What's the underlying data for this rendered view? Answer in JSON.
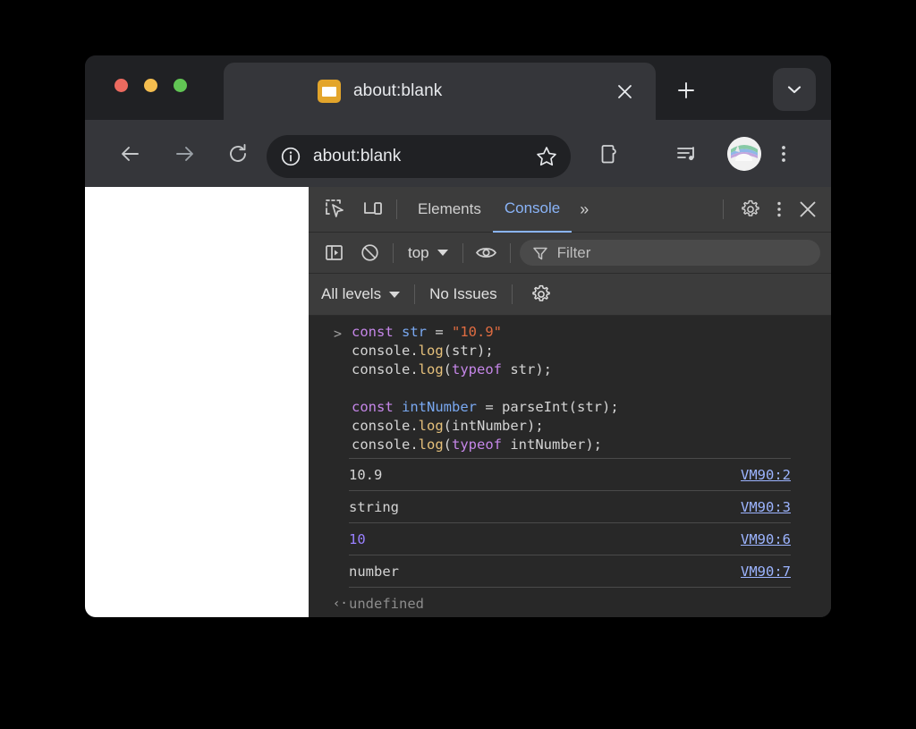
{
  "browser": {
    "tab": {
      "title": "about:blank",
      "favicon": "page-favicon",
      "close_label": "×"
    },
    "new_tab_label": "+",
    "tab_list_menu": "chevron-down-icon",
    "toolbar": {
      "back": "back-arrow-icon",
      "forward": "forward-arrow-icon",
      "reload": "reload-icon",
      "url": "about:blank",
      "site_info": "info-icon",
      "bookmark": "star-icon",
      "extensions": "extensions-puzzle-icon",
      "media": "media-list-icon",
      "profile": "avatar-unicorn",
      "menu": "three-dot-menu-icon"
    }
  },
  "devtools": {
    "header": {
      "inspect_icon": "inspect-element-icon",
      "device_icon": "device-toolbar-icon",
      "tabs": [
        {
          "label": "Elements",
          "active": false
        },
        {
          "label": "Console",
          "active": true
        }
      ],
      "more_tabs": "»",
      "settings_icon": "gear-icon",
      "menu_icon": "three-dot-menu-icon",
      "close_icon": "close-icon"
    },
    "console_bar": {
      "sidebar_icon": "console-sidebar-icon",
      "clear_icon": "clear-console-icon",
      "context": "top",
      "eye_icon": "live-expression-eye-icon",
      "filter_icon": "filter-funnel-icon",
      "filter_placeholder": "Filter",
      "filter_value": ""
    },
    "console_bar2": {
      "levels": "All levels",
      "issues": "No Issues",
      "settings_icon": "gear-icon"
    },
    "console": {
      "prompt_symbol": ">",
      "input_lines": [
        [
          {
            "t": "const",
            "c": "k-const"
          },
          {
            "t": " ",
            "c": "k-plain"
          },
          {
            "t": "str",
            "c": "k-var"
          },
          {
            "t": " = ",
            "c": "k-op"
          },
          {
            "t": "\"10.9\"",
            "c": "k-str"
          }
        ],
        [
          {
            "t": "console",
            "c": "k-plain"
          },
          {
            "t": ".",
            "c": "k-plain"
          },
          {
            "t": "log",
            "c": "k-yellow"
          },
          {
            "t": "(str);",
            "c": "k-plain"
          }
        ],
        [
          {
            "t": "console",
            "c": "k-plain"
          },
          {
            "t": ".",
            "c": "k-plain"
          },
          {
            "t": "log",
            "c": "k-yellow"
          },
          {
            "t": "(",
            "c": "k-plain"
          },
          {
            "t": "typeof",
            "c": "k-typeof"
          },
          {
            "t": " str);",
            "c": "k-plain"
          }
        ],
        [
          {
            "t": " ",
            "c": "k-plain"
          }
        ],
        [
          {
            "t": "const",
            "c": "k-const"
          },
          {
            "t": " ",
            "c": "k-plain"
          },
          {
            "t": "intNumber",
            "c": "k-var"
          },
          {
            "t": " = parseInt(str);",
            "c": "k-op"
          }
        ],
        [
          {
            "t": "console",
            "c": "k-plain"
          },
          {
            "t": ".",
            "c": "k-plain"
          },
          {
            "t": "log",
            "c": "k-yellow"
          },
          {
            "t": "(intNumber);",
            "c": "k-plain"
          }
        ],
        [
          {
            "t": "console",
            "c": "k-plain"
          },
          {
            "t": ".",
            "c": "k-plain"
          },
          {
            "t": "log",
            "c": "k-yellow"
          },
          {
            "t": "(",
            "c": "k-plain"
          },
          {
            "t": "typeof",
            "c": "k-typeof"
          },
          {
            "t": " intNumber);",
            "c": "k-plain"
          }
        ]
      ],
      "outputs": [
        {
          "value": "10.9",
          "kind": "string",
          "source": "VM90:2"
        },
        {
          "value": "string",
          "kind": "string",
          "source": "VM90:3"
        },
        {
          "value": "10",
          "kind": "number",
          "source": "VM90:6"
        },
        {
          "value": "number",
          "kind": "string",
          "source": "VM90:7"
        }
      ],
      "result": {
        "arrow": "‹·",
        "value": "undefined"
      }
    }
  },
  "colors": {
    "accent_blue": "#8ab4f8",
    "link_blue": "#9cb4ff",
    "number_purple": "#9980ff",
    "keyword_purple": "#c586e8",
    "string_orange": "#e06c41",
    "variable_blue": "#79a8f0",
    "method_yellow": "#e5c07b",
    "window_bg": "#202124",
    "toolbar_bg": "#35363a",
    "devtools_head_bg": "#3c3c3c",
    "console_bg": "#282828"
  }
}
